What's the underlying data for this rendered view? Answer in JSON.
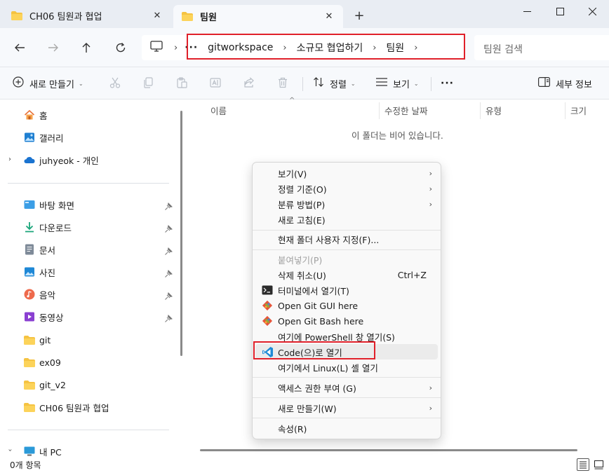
{
  "tabs": [
    {
      "label": "CH06 팀원과 협업",
      "close": "✕"
    },
    {
      "label": "팀원",
      "close": "✕"
    }
  ],
  "new_tab": "+",
  "window_controls": {
    "minimize": "—",
    "maximize": "☐",
    "close": "✕"
  },
  "breadcrumb": {
    "overflow": "···",
    "items": [
      "gitworkspace",
      "소규모 협업하기",
      "팀원"
    ],
    "separator": "›"
  },
  "search": {
    "placeholder": "팀원 검색"
  },
  "toolbar": {
    "new_label": "새로 만들기",
    "sort_label": "정렬",
    "view_label": "보기",
    "more": "···",
    "details_label": "세부 정보",
    "chevron": "⌄"
  },
  "sidebar": {
    "top": [
      {
        "label": "홈",
        "icon": "home-icon"
      },
      {
        "label": "갤러리",
        "icon": "gallery-icon"
      },
      {
        "label": "juhyeok - 개인",
        "icon": "onedrive-icon"
      }
    ],
    "pinned": [
      {
        "label": "바탕 화면",
        "icon": "desktop-icon"
      },
      {
        "label": "다운로드",
        "icon": "download-icon"
      },
      {
        "label": "문서",
        "icon": "document-icon"
      },
      {
        "label": "사진",
        "icon": "pictures-icon"
      },
      {
        "label": "음악",
        "icon": "music-icon"
      },
      {
        "label": "동영상",
        "icon": "video-icon"
      }
    ],
    "folders": [
      "git",
      "ex09",
      "git_v2",
      "CH06 팀원과 협업"
    ],
    "this_pc": "내 PC"
  },
  "columns": [
    "이름",
    "수정한 날짜",
    "유형",
    "크기"
  ],
  "empty_message": "이 폴더는 비어 있습니다.",
  "status": {
    "item_count": "0개 항목"
  },
  "context_menu": {
    "items": [
      {
        "label": "보기(V)",
        "submenu": true
      },
      {
        "label": "정렬 기준(O)",
        "submenu": true
      },
      {
        "label": "분류 방법(P)",
        "submenu": true
      },
      {
        "label": "새로 고침(E)"
      },
      {
        "label": "현재 폴더 사용자 지정(F)..."
      },
      {
        "label": "붙여넣기(P)",
        "disabled": true
      },
      {
        "label": "삭제 취소(U)",
        "shortcut": "Ctrl+Z"
      },
      {
        "label": "터미널에서 열기(T)",
        "icon": "terminal-icon"
      },
      {
        "label": "Open Git GUI here",
        "icon": "git-icon"
      },
      {
        "label": "Open Git Bash here",
        "icon": "git-icon"
      },
      {
        "label": "여기에 PowerShell 창 열기(S)"
      },
      {
        "label": "Code(으)로 열기",
        "icon": "vscode-icon",
        "highlighted": true
      },
      {
        "label": "여기에서 Linux(L) 셸 열기"
      },
      {
        "label": "액세스 권한 부여 (G)",
        "submenu": true
      },
      {
        "label": "새로 만들기(W)",
        "submenu": true
      },
      {
        "label": "속성(R)"
      }
    ],
    "arrow": "›"
  },
  "colors": {
    "highlight_box": "#e0202a",
    "folder": "#f5c342",
    "accent": "#0067c0"
  }
}
